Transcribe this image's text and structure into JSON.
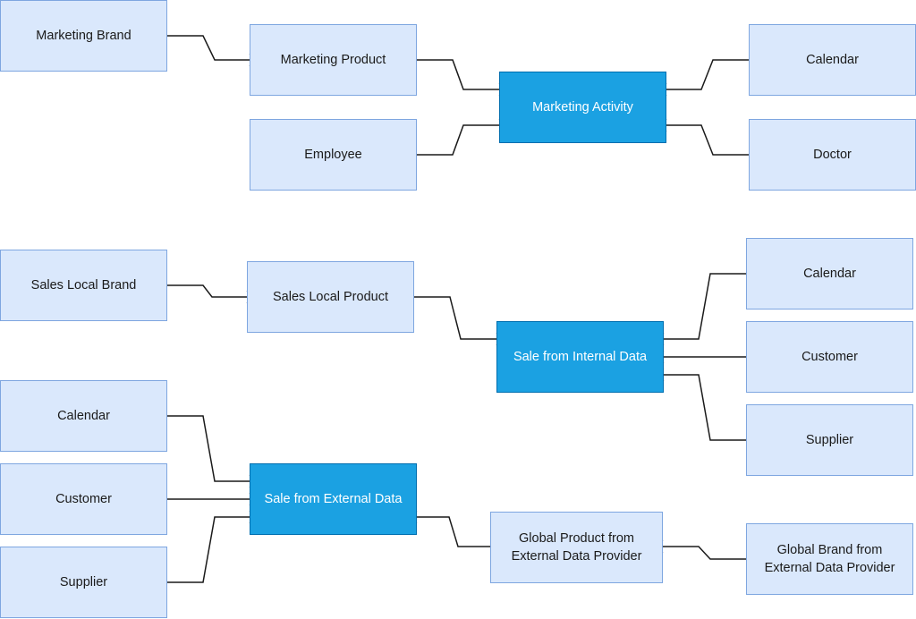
{
  "diagram": {
    "type": "entity-relationship",
    "colors": {
      "entity_fill": "#dae8fc",
      "entity_border": "#7ea6e0",
      "fact_fill": "#1ba1e2",
      "fact_border": "#006eaf",
      "line": "#1a1a1a"
    },
    "entities": [
      {
        "id": "marketing-brand",
        "label": "Marketing Brand",
        "kind": "dimension"
      },
      {
        "id": "marketing-product",
        "label": "Marketing Product",
        "kind": "dimension"
      },
      {
        "id": "employee",
        "label": "Employee",
        "kind": "dimension"
      },
      {
        "id": "marketing-activity",
        "label": "Marketing Activity",
        "kind": "fact"
      },
      {
        "id": "calendar-1",
        "label": "Calendar",
        "kind": "dimension"
      },
      {
        "id": "doctor",
        "label": "Doctor",
        "kind": "dimension"
      },
      {
        "id": "sales-local-brand",
        "label": "Sales Local Brand",
        "kind": "dimension"
      },
      {
        "id": "sales-local-product",
        "label": "Sales Local Product",
        "kind": "dimension"
      },
      {
        "id": "sale-internal",
        "label": "Sale from Internal Data",
        "kind": "fact"
      },
      {
        "id": "calendar-2",
        "label": "Calendar",
        "kind": "dimension"
      },
      {
        "id": "customer-2",
        "label": "Customer",
        "kind": "dimension"
      },
      {
        "id": "supplier-2",
        "label": "Supplier",
        "kind": "dimension"
      },
      {
        "id": "calendar-3",
        "label": "Calendar",
        "kind": "dimension"
      },
      {
        "id": "customer-3",
        "label": "Customer",
        "kind": "dimension"
      },
      {
        "id": "supplier-3",
        "label": "Supplier",
        "kind": "dimension"
      },
      {
        "id": "sale-external",
        "label": "Sale from External Data",
        "kind": "fact"
      },
      {
        "id": "global-product",
        "label": "Global Product from External Data Provider",
        "kind": "dimension"
      },
      {
        "id": "global-brand",
        "label": "Global Brand from External Data Provider",
        "kind": "dimension"
      }
    ],
    "relationships": [
      {
        "from": "marketing-brand",
        "to": "marketing-product",
        "cardinality": "one-to-many"
      },
      {
        "from": "marketing-product",
        "to": "marketing-activity",
        "cardinality": "one-to-many"
      },
      {
        "from": "employee",
        "to": "marketing-activity",
        "cardinality": "one-to-many"
      },
      {
        "from": "calendar-1",
        "to": "marketing-activity",
        "cardinality": "one-to-many"
      },
      {
        "from": "doctor",
        "to": "marketing-activity",
        "cardinality": "one-to-many"
      },
      {
        "from": "sales-local-brand",
        "to": "sales-local-product",
        "cardinality": "one-to-many"
      },
      {
        "from": "sales-local-product",
        "to": "sale-internal",
        "cardinality": "one-to-many"
      },
      {
        "from": "calendar-2",
        "to": "sale-internal",
        "cardinality": "one-to-many"
      },
      {
        "from": "customer-2",
        "to": "sale-internal",
        "cardinality": "one-to-many"
      },
      {
        "from": "supplier-2",
        "to": "sale-internal",
        "cardinality": "one-to-many"
      },
      {
        "from": "calendar-3",
        "to": "sale-external",
        "cardinality": "one-to-many"
      },
      {
        "from": "customer-3",
        "to": "sale-external",
        "cardinality": "one-to-many"
      },
      {
        "from": "supplier-3",
        "to": "sale-external",
        "cardinality": "one-to-many"
      },
      {
        "from": "global-product",
        "to": "sale-external",
        "cardinality": "one-to-many"
      },
      {
        "from": "global-brand",
        "to": "global-product",
        "cardinality": "one-to-many"
      }
    ]
  }
}
